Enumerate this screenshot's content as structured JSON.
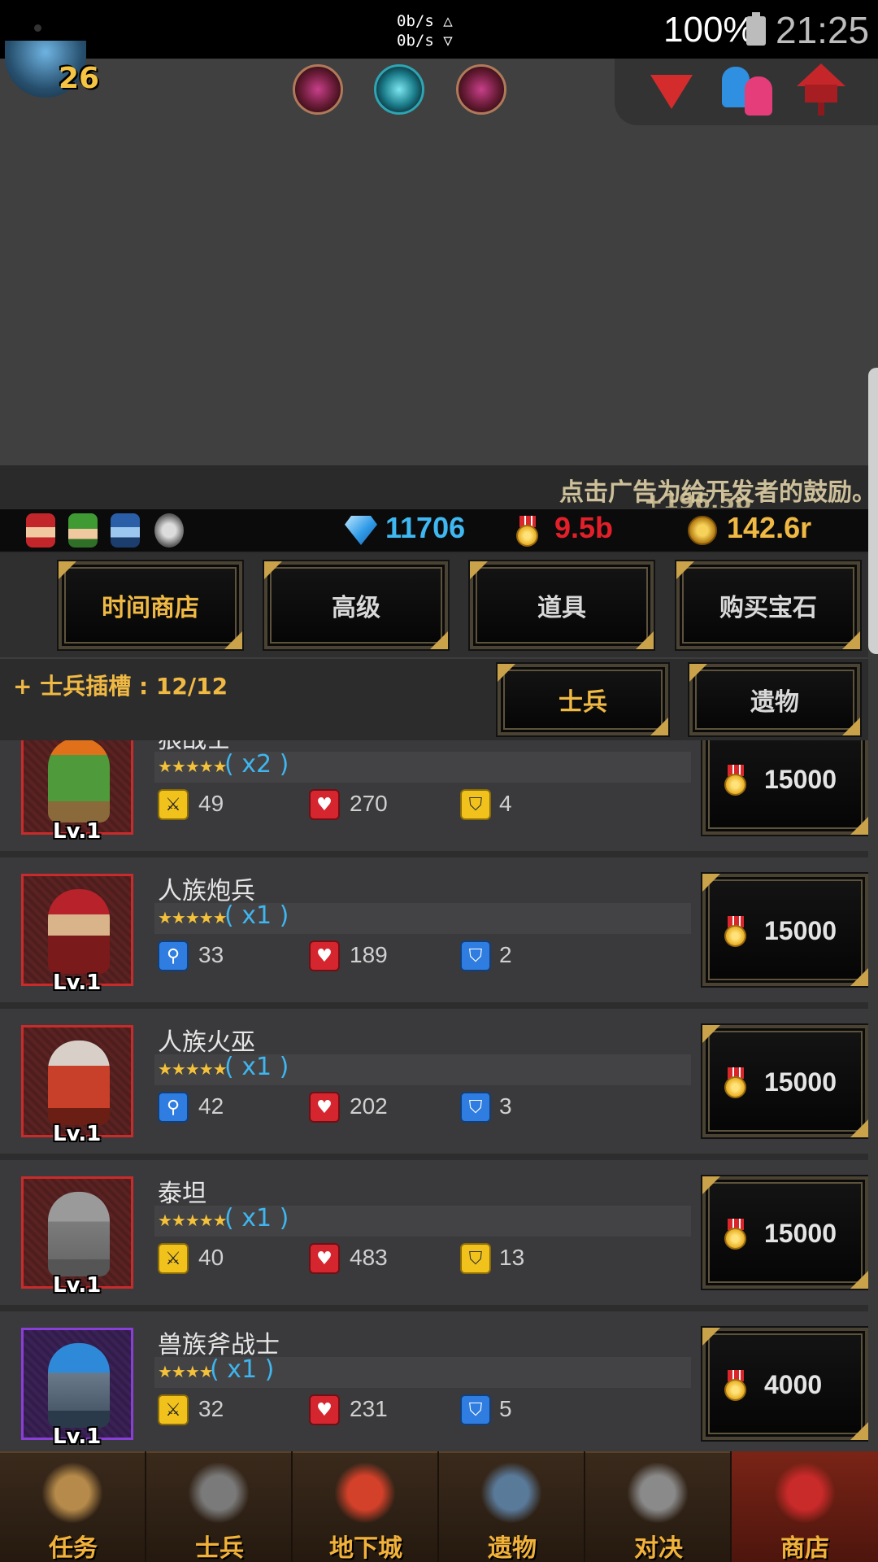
{
  "status_bar": {
    "net_up": "0b/s △",
    "net_down": "0b/s ▽",
    "battery": "100%",
    "time": "21:25"
  },
  "player": {
    "level": "26"
  },
  "ticker": {
    "text": "点击广告为给开发者的鼓励。",
    "floating_gain": "+196.5p"
  },
  "currency": {
    "gems": "11706",
    "medals": "9.5b",
    "gold": "142.6r",
    "gems_color": "#3fb8f2",
    "medals_color": "#e3202a",
    "gold_color": "#f0b943"
  },
  "shop_tabs": [
    {
      "label": "时间商店",
      "active": true
    },
    {
      "label": "高级",
      "active": false
    },
    {
      "label": "道具",
      "active": false
    },
    {
      "label": "购买宝石",
      "active": false
    }
  ],
  "sub_tabs": [
    {
      "label": "士兵",
      "active": true
    },
    {
      "label": "遗物",
      "active": false
    }
  ],
  "slots": {
    "label": "+ 士兵插槽 : 12/12"
  },
  "units": [
    {
      "name": "狼战士",
      "stars": "★★★★★",
      "multiplier": "( x2 )",
      "level": "Lv.1",
      "attack": "49",
      "attack_type": "sword",
      "hp": "270",
      "defense": "4",
      "defense_type": "yellow",
      "price": "15000",
      "frame": "red"
    },
    {
      "name": "人族炮兵",
      "stars": "★★★★★",
      "multiplier": "( x1 )",
      "level": "Lv.1",
      "attack": "33",
      "attack_type": "magic",
      "hp": "189",
      "defense": "2",
      "defense_type": "blue",
      "price": "15000",
      "frame": "red"
    },
    {
      "name": "人族火巫",
      "stars": "★★★★★",
      "multiplier": "( x1 )",
      "level": "Lv.1",
      "attack": "42",
      "attack_type": "magic",
      "hp": "202",
      "defense": "3",
      "defense_type": "blue",
      "price": "15000",
      "frame": "red"
    },
    {
      "name": "泰坦",
      "stars": "★★★★★",
      "multiplier": "( x1 )",
      "level": "Lv.1",
      "attack": "40",
      "attack_type": "sword",
      "hp": "483",
      "defense": "13",
      "defense_type": "yellow",
      "price": "15000",
      "frame": "red"
    },
    {
      "name": "兽族斧战士",
      "stars": "★★★★",
      "multiplier": "( x1 )",
      "level": "Lv.1",
      "attack": "32",
      "attack_type": "sword",
      "hp": "231",
      "defense": "5",
      "defense_type": "blue",
      "price": "4000",
      "frame": "purple"
    }
  ],
  "bottom_nav": [
    {
      "label": "任务",
      "icon": "scroll-icon",
      "active": false
    },
    {
      "label": "士兵",
      "icon": "soldier-helmet-icon",
      "active": false
    },
    {
      "label": "地下城",
      "icon": "dungeon-monster-icon",
      "active": false
    },
    {
      "label": "遗物",
      "icon": "relic-orb-icon",
      "active": false
    },
    {
      "label": "对决",
      "icon": "crossed-swords-icon",
      "active": false
    },
    {
      "label": "商店",
      "icon": "shop-stall-icon",
      "active": true
    }
  ]
}
